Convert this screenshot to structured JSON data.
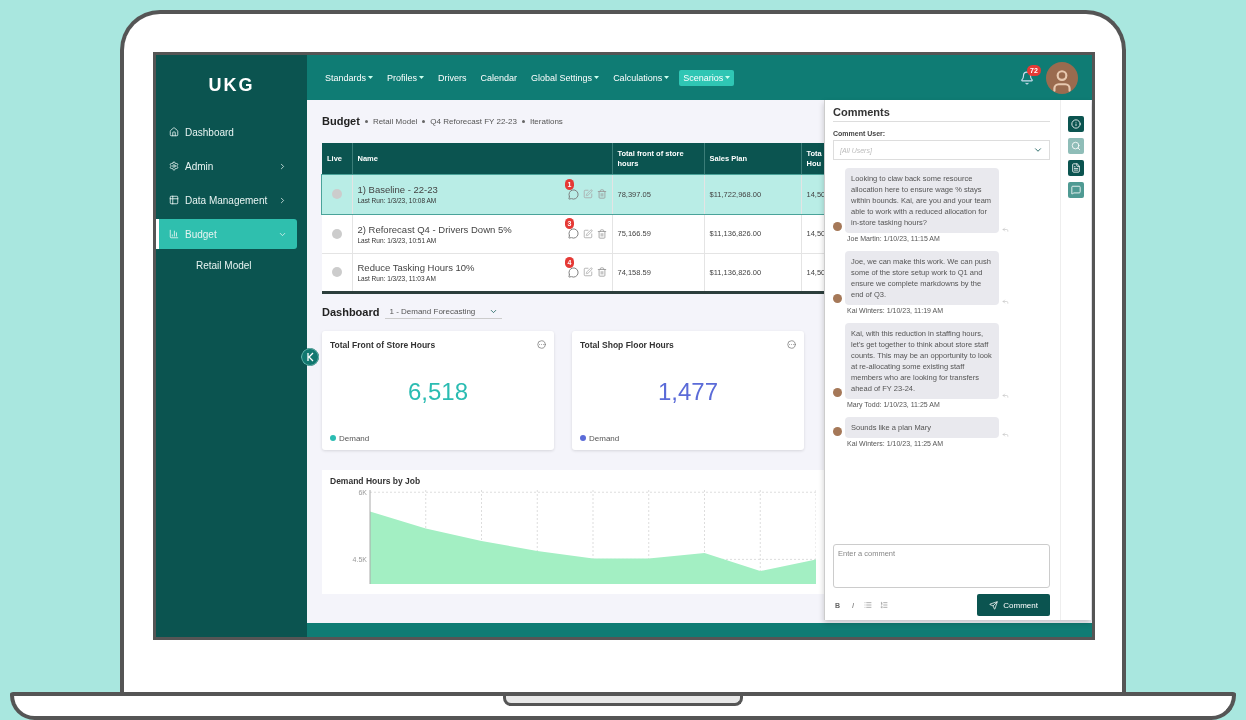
{
  "sidebar": {
    "logo": "UKG",
    "items": [
      {
        "label": "Dashboard",
        "kind": "home",
        "selected": false,
        "expandable": false
      },
      {
        "label": "Admin",
        "kind": "gear",
        "selected": false,
        "expandable": true,
        "expanded": false
      },
      {
        "label": "Data Management",
        "kind": "table",
        "selected": false,
        "expandable": true,
        "expanded": false
      },
      {
        "label": "Budget",
        "kind": "chart",
        "selected": true,
        "expandable": true,
        "expanded": true,
        "children": [
          {
            "label": "Retail Model"
          }
        ]
      }
    ]
  },
  "nav": [
    {
      "label": "Standards",
      "dropdown": true,
      "selected": false
    },
    {
      "label": "Profiles",
      "dropdown": true,
      "selected": false
    },
    {
      "label": "Drivers",
      "dropdown": false,
      "selected": false
    },
    {
      "label": "Calendar",
      "dropdown": false,
      "selected": false
    },
    {
      "label": "Global Settings",
      "dropdown": true,
      "selected": false
    },
    {
      "label": "Calculations",
      "dropdown": true,
      "selected": false
    },
    {
      "label": "Scenarios",
      "dropdown": true,
      "selected": true
    }
  ],
  "notifications": {
    "count": "72"
  },
  "breadcrumb": {
    "title": "Budget",
    "path": [
      "Retail Model",
      "Q4 Reforecast FY 22-23",
      "Iterations"
    ]
  },
  "table": {
    "columns": [
      "Live",
      "Name",
      "Total front of store hours",
      "Sales Plan",
      "Tota Hou"
    ],
    "rows": [
      {
        "name": "1) Baseline - 22-23",
        "last_run": "Last Run: 1/3/23, 10:08 AM",
        "comments": "1",
        "front_hours": "78,397.05",
        "sales_plan": "$11,722,968.00",
        "column_5": "14,50",
        "selected": true
      },
      {
        "name": "2) Reforecast Q4 - Drivers Down 5%",
        "last_run": "Last Run: 1/3/23, 10:51 AM",
        "comments": "3",
        "front_hours": "75,166.59",
        "sales_plan": "$11,136,826.00",
        "column_5": "14,50",
        "selected": false
      },
      {
        "name": "Reduce Tasking Hours 10%",
        "last_run": "Last Run: 1/3/23, 11:03 AM",
        "comments": "4",
        "front_hours": "74,158.59",
        "sales_plan": "$11,136,826.00",
        "column_5": "14,50",
        "selected": false
      }
    ]
  },
  "dashboard": {
    "title": "Dashboard",
    "view": "1 - Demand Forecasting",
    "tiles": [
      {
        "title": "Total Front of Store Hours",
        "value": "6,518",
        "legend": "Demand",
        "color": "#2bbcb2"
      },
      {
        "title": "Total Shop Floor Hours",
        "value": "1,477",
        "legend": "Demand",
        "color": "#5b6bd8"
      }
    ],
    "chart": {
      "chart_data": {
        "type": "area",
        "title": "Demand Hours by Job",
        "grid": true,
        "series": [
          {
            "color": "#a3efc3",
            "values": [
              5570,
              5190,
              4910,
              4690,
              4520,
              4520,
              4640,
              4240,
              4500
            ]
          }
        ],
        "ylim": [
          3950,
          6050
        ],
        "yticks": [
          {
            "value": 6000,
            "label": "6K"
          },
          {
            "value": 4500,
            "label": "4.5K"
          }
        ]
      }
    }
  },
  "comments_panel": {
    "title": "Comments",
    "user_label": "Comment User:",
    "user_placeholder": "[All Users]",
    "comments": [
      {
        "text": "Looking to claw back some resource allocation here to ensure wage % stays within bounds. Kai, are you and your team able to work with a reduced allocation for in-store tasking hours?",
        "meta": "Joe Martin: 1/10/23, 11:15 AM"
      },
      {
        "text": "Joe, we can make this work. We can push some of the store setup work to Q1 and ensure we complete markdowns by the end of Q3.",
        "meta": "Kai Winters: 1/10/23, 11:19 AM"
      },
      {
        "text": "Kai, with this reduction in staffing hours, let's get together to think about store staff counts. This may be an opportunity to look at re-allocating some existing staff members who are looking for transfers ahead of FY 23-24.",
        "meta": "Mary Todd: 1/10/23, 11:25 AM"
      },
      {
        "text": "Sounds like a plan Mary",
        "meta": "Kai Winters: 1/10/23, 11:25 AM"
      }
    ],
    "input_placeholder": "Enter a comment",
    "format_buttons": [
      "B",
      "I"
    ],
    "submit": "Comment"
  }
}
